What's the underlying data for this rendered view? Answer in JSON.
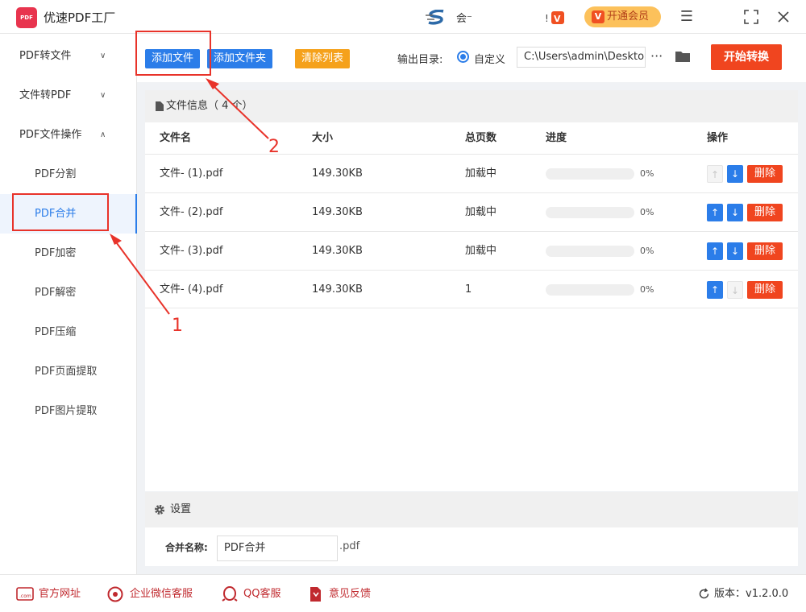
{
  "app": {
    "title": "优速PDF工厂",
    "logo_text": "PDF"
  },
  "user": {
    "name": "会⁻"
  },
  "vip": {
    "label": "开通会员",
    "mini_label": "VIP"
  },
  "sidebar": {
    "groups": [
      {
        "label": "PDF转文件",
        "chevron": "∨"
      },
      {
        "label": "文件转PDF",
        "chevron": "∨"
      },
      {
        "label": "PDF文件操作",
        "chevron": "∧"
      }
    ],
    "items": [
      {
        "label": "PDF分割"
      },
      {
        "label": "PDF合并"
      },
      {
        "label": "PDF加密"
      },
      {
        "label": "PDF解密"
      },
      {
        "label": "PDF压缩"
      },
      {
        "label": "PDF页面提取"
      },
      {
        "label": "PDF图片提取"
      }
    ],
    "active_item": "PDF合并"
  },
  "toolbar": {
    "add_file": "添加文件",
    "add_folder": "添加文件夹",
    "clear_list": "清除列表",
    "output_label": "输出目录:",
    "custom_label": "自定义",
    "output_path": "C:\\Users\\admin\\Deskto",
    "more": "···",
    "start": "开始转换"
  },
  "file_panel": {
    "header": "文件信息（ 4 个）",
    "columns": [
      "文件名",
      "大小",
      "总页数",
      "进度",
      "操作"
    ],
    "rows": [
      {
        "name": "文件- (1).pdf",
        "size": "149.30KB",
        "pages": "加载中",
        "progress": "0%",
        "up_enabled": false,
        "down_enabled": true
      },
      {
        "name": "文件- (2).pdf",
        "size": "149.30KB",
        "pages": "加载中",
        "progress": "0%",
        "up_enabled": true,
        "down_enabled": true
      },
      {
        "name": "文件- (3).pdf",
        "size": "149.30KB",
        "pages": "加载中",
        "progress": "0%",
        "up_enabled": true,
        "down_enabled": true
      },
      {
        "name": "文件- (4).pdf",
        "size": "149.30KB",
        "pages": "1",
        "progress": "0%",
        "up_enabled": true,
        "down_enabled": false
      }
    ],
    "delete_label": "删除"
  },
  "settings": {
    "header": "设置",
    "merge_name_label": "合并名称:",
    "merge_name_value": "PDF合并",
    "merge_suffix": ".pdf"
  },
  "footer": {
    "links": [
      "官方网址",
      "企业微信客服",
      "QQ客服",
      "意见反馈"
    ],
    "version": "版本：v1.2.0.0"
  },
  "annotations": {
    "label_1": "1",
    "label_2": "2"
  },
  "colors": {
    "primary": "#2b7de9",
    "danger": "#f0451f",
    "orange": "#f5a11b",
    "vip": "#fcc15b",
    "annotation": "#e8332a"
  }
}
